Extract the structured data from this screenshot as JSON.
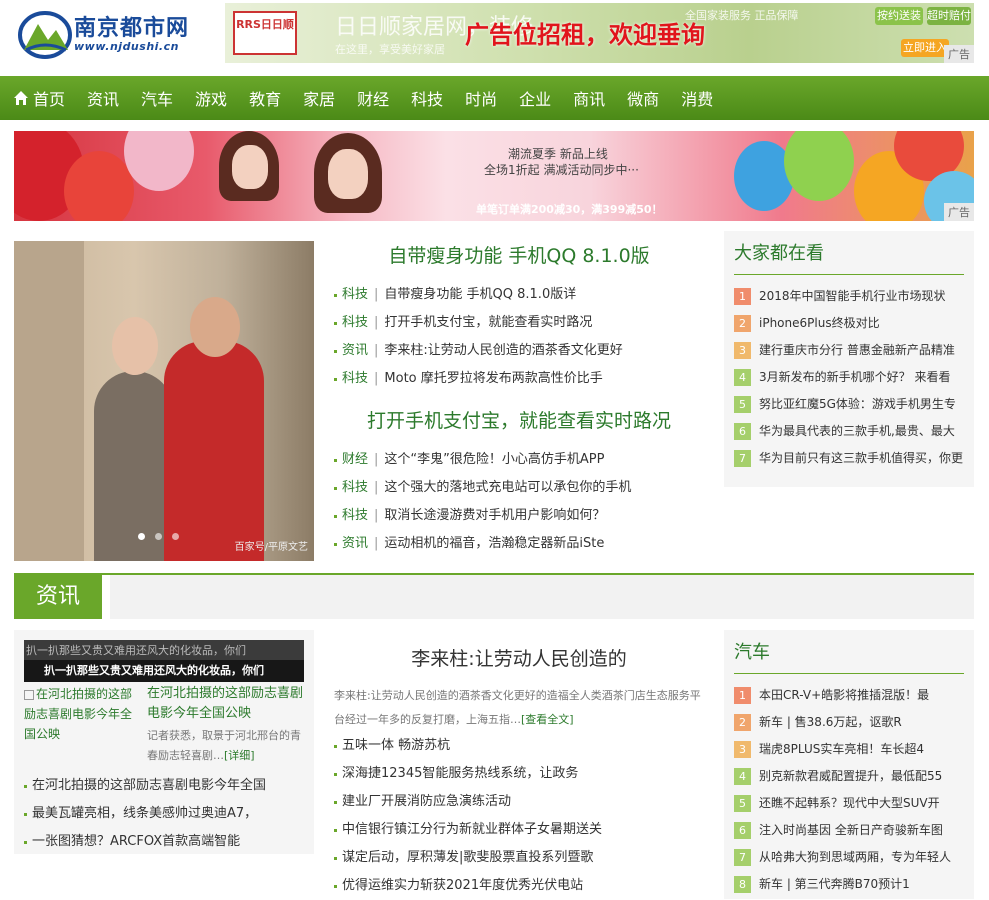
{
  "site": {
    "logo_cn": "南京都市网",
    "logo_en": "www.njdushi.cn"
  },
  "top_ad": {
    "brand_box": "RRS日日顺",
    "ghost_text": "日日顺家居网，装修",
    "ghost_sub": "在这里，享受美好家居",
    "headline": "广告位招租，欢迎垂询",
    "right_text": "全国家装服务 正品保障",
    "btn1": "按约送装",
    "btn2": "超时赔付",
    "btn3": "立即进入",
    "tag": "广告"
  },
  "nav": {
    "items": [
      "首页",
      "资讯",
      "汽车",
      "游戏",
      "教育",
      "家居",
      "财经",
      "科技",
      "时尚",
      "企业",
      "商讯",
      "微商",
      "消费"
    ]
  },
  "banner": {
    "line1": "潮流夏季 新品上线",
    "line2": "全场1折起 满减活动同步中···",
    "line3": "单笔订单满200减30，满399减50！",
    "tag": "广告"
  },
  "hero": {
    "watermark": "百家号/平原文艺"
  },
  "headlines": {
    "title1": "自带瘦身功能 手机QQ 8.1.0版",
    "list1": [
      {
        "cat": "科技",
        "text": "自带瘦身功能 手机QQ 8.1.0版详"
      },
      {
        "cat": "科技",
        "text": "打开手机支付宝，就能查看实时路况"
      },
      {
        "cat": "资讯",
        "text": "李来柱:让劳动人民创造的酒茶香文化更好"
      },
      {
        "cat": "科技",
        "text": "Moto 摩托罗拉将发布两款高性价比手"
      }
    ],
    "title2": "打开手机支付宝，就能查看实时路况",
    "list2": [
      {
        "cat": "财经",
        "text": "这个“李鬼”很危险！小心高仿手机APP"
      },
      {
        "cat": "科技",
        "text": "这个强大的落地式充电站可以承包你的手机"
      },
      {
        "cat": "科技",
        "text": "取消长途漫游费对手机用户影响如何？"
      },
      {
        "cat": "资讯",
        "text": "运动相机的福音，浩瀚稳定器新品iSte"
      }
    ]
  },
  "hot": {
    "title": "大家都在看",
    "items": [
      "2018年中国智能手机行业市场现状",
      "iPhone6Plus终极对比",
      "建行重庆市分行 普惠金融新产品精准",
      "3月新发布的新手机哪个好？ 来看看",
      "努比亚红魔5G体验：游戏手机男生专",
      "华为最具代表的三款手机,最贵、最大",
      "华为目前只有这三款手机值得买，你更"
    ]
  },
  "section": {
    "title": "资讯"
  },
  "left_news": {
    "img_alt": "扒一扒那些又贵又难用还风大的化妆品，你们",
    "img_caption": "扒一扒那些又贵又难用还风大的化妆品，你们",
    "thumb_alt": "在河北拍摄的这部励志喜剧电影今年全国公映",
    "title": "在河北拍摄的这部励志喜剧电影今年全国公映",
    "desc": "记者获悉，取景于河北邢台的青春励志轻喜剧…",
    "more": "[详细]",
    "list": [
      "在河北拍摄的这部励志喜剧电影今年全国",
      "最美瓦罐亮相，线条美感帅过奥迪A7，",
      "一张图猜想？ARCFOX首款高端智能"
    ]
  },
  "mid_news": {
    "title": "李来柱:让劳动人民创造的",
    "desc": "李来柱:让劳动人民创造的酒茶香文化更好的造福全人类酒茶门店生态服务平台经过一年多的反复打磨，上海五指…",
    "more": "[查看全文]",
    "list": [
      "五味一体 畅游苏杭",
      "深海捷12345智能服务热线系统，让政务",
      "建业厂开展消防应急演练活动",
      "中信银行镇江分行为新就业群体子女暑期送关",
      "谋定后动，厚积薄发|歌斐股票直投系列暨歌",
      "优得运维实力斩获2021年度优秀光伏电站"
    ]
  },
  "auto": {
    "title": "汽车",
    "items": [
      "本田CR-V+皓影将推插混版！最",
      "新车 | 售38.6万起，讴歌R",
      "瑞虎8PLUS实车亮相！车长超4",
      "别克新款君威配置提升，最低配55",
      "还瞧不起韩系？现代中大型SUV开",
      "注入时尚基因 全新日产奇骏新车图",
      "从哈弗大狗到思域两厢，专为年轻人",
      "新车 | 第三代奔腾B70预计1"
    ]
  }
}
